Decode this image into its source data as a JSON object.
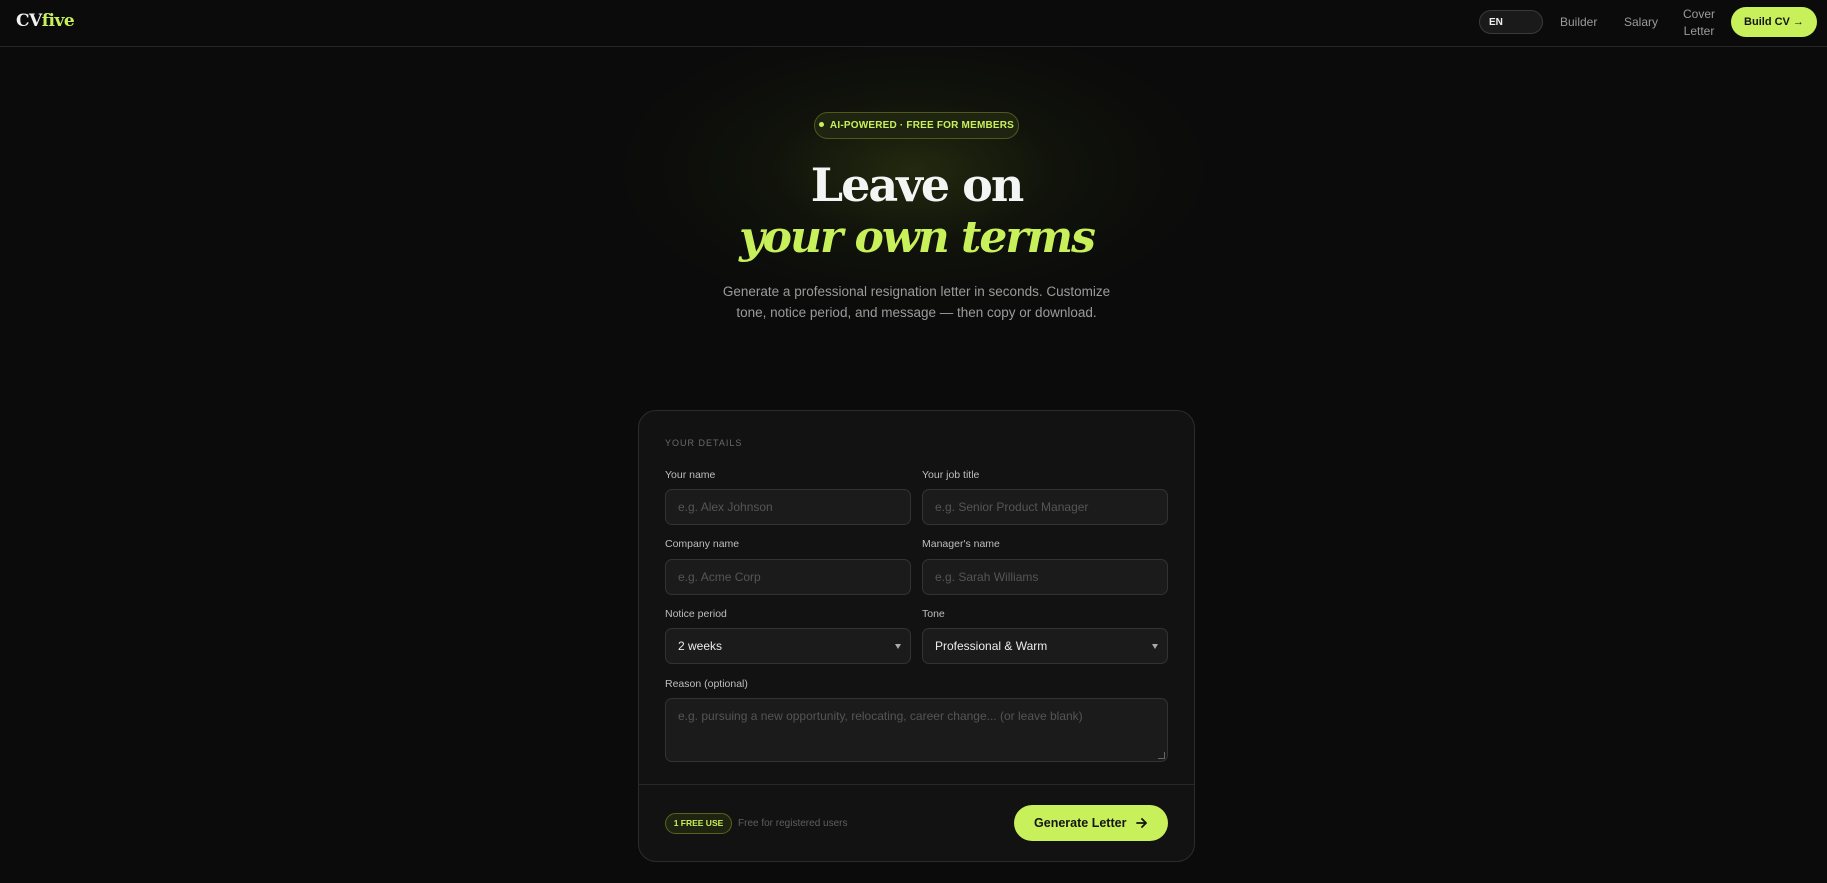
{
  "header": {
    "logo_main": "CV",
    "logo_accent": "five",
    "language": "EN",
    "nav": [
      "Builder",
      "Salary",
      "Cover Letter"
    ],
    "cta": "Build CV →"
  },
  "hero": {
    "badge": "AI-POWERED · FREE FOR MEMBERS",
    "title": "Leave on",
    "title_accent": "your own terms",
    "subtitle": "Generate a professional resignation letter in seconds. Customize tone, notice period, and message — then copy or download."
  },
  "form": {
    "section_label": "YOUR DETAILS",
    "name_label": "Your name",
    "name_placeholder": "e.g. Alex Johnson",
    "job_label": "Your job title",
    "job_placeholder": "e.g. Senior Product Manager",
    "company_label": "Company name",
    "company_placeholder": "e.g. Acme Corp",
    "manager_label": "Manager's name",
    "manager_placeholder": "e.g. Sarah Williams",
    "notice_label": "Notice period",
    "notice_value": "2 weeks",
    "tone_label": "Tone",
    "tone_value": "Professional & Warm",
    "reason_label": "Reason (optional)",
    "reason_placeholder": "e.g. pursuing a new opportunity, relocating, career change... (or leave blank)"
  },
  "footer": {
    "free_badge": "1 FREE USE",
    "free_note": "Free for registered users",
    "generate_label": "Generate Letter"
  },
  "colors": {
    "accent": "#c8f05a",
    "background": "#0b0b0b",
    "card": "#121212"
  }
}
